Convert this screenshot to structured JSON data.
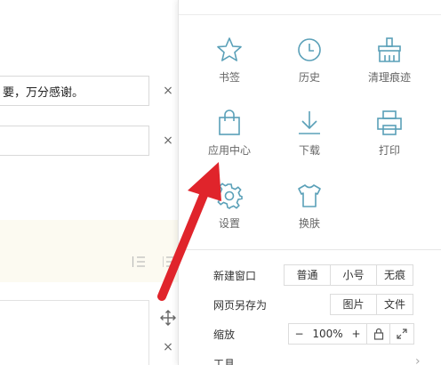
{
  "left_page": {
    "field1_text": "要，万分感谢。",
    "field2_text": "",
    "close_glyph": "×"
  },
  "menu": {
    "grid": [
      {
        "label": "书签",
        "icon": "star-icon"
      },
      {
        "label": "历史",
        "icon": "clock-icon"
      },
      {
        "label": "清理痕迹",
        "icon": "broom-icon"
      },
      {
        "label": "应用中心",
        "icon": "bag-icon"
      },
      {
        "label": "下载",
        "icon": "download-icon"
      },
      {
        "label": "打印",
        "icon": "printer-icon"
      },
      {
        "label": "设置",
        "icon": "gear-icon"
      },
      {
        "label": "换肤",
        "icon": "tshirt-icon"
      }
    ],
    "new_window": {
      "label": "新建窗口",
      "options": [
        "普通",
        "小号",
        "无痕"
      ]
    },
    "save_as": {
      "label": "网页另存为",
      "options": [
        "图片",
        "文件"
      ]
    },
    "zoom": {
      "label": "缩放",
      "minus": "−",
      "value": "100%",
      "plus": "+"
    },
    "tools": {
      "label": "工具",
      "arrow": "›"
    }
  },
  "colors": {
    "icon": "#5aa0b8",
    "arrow": "#e0242b",
    "band": "#fcfaf1"
  }
}
